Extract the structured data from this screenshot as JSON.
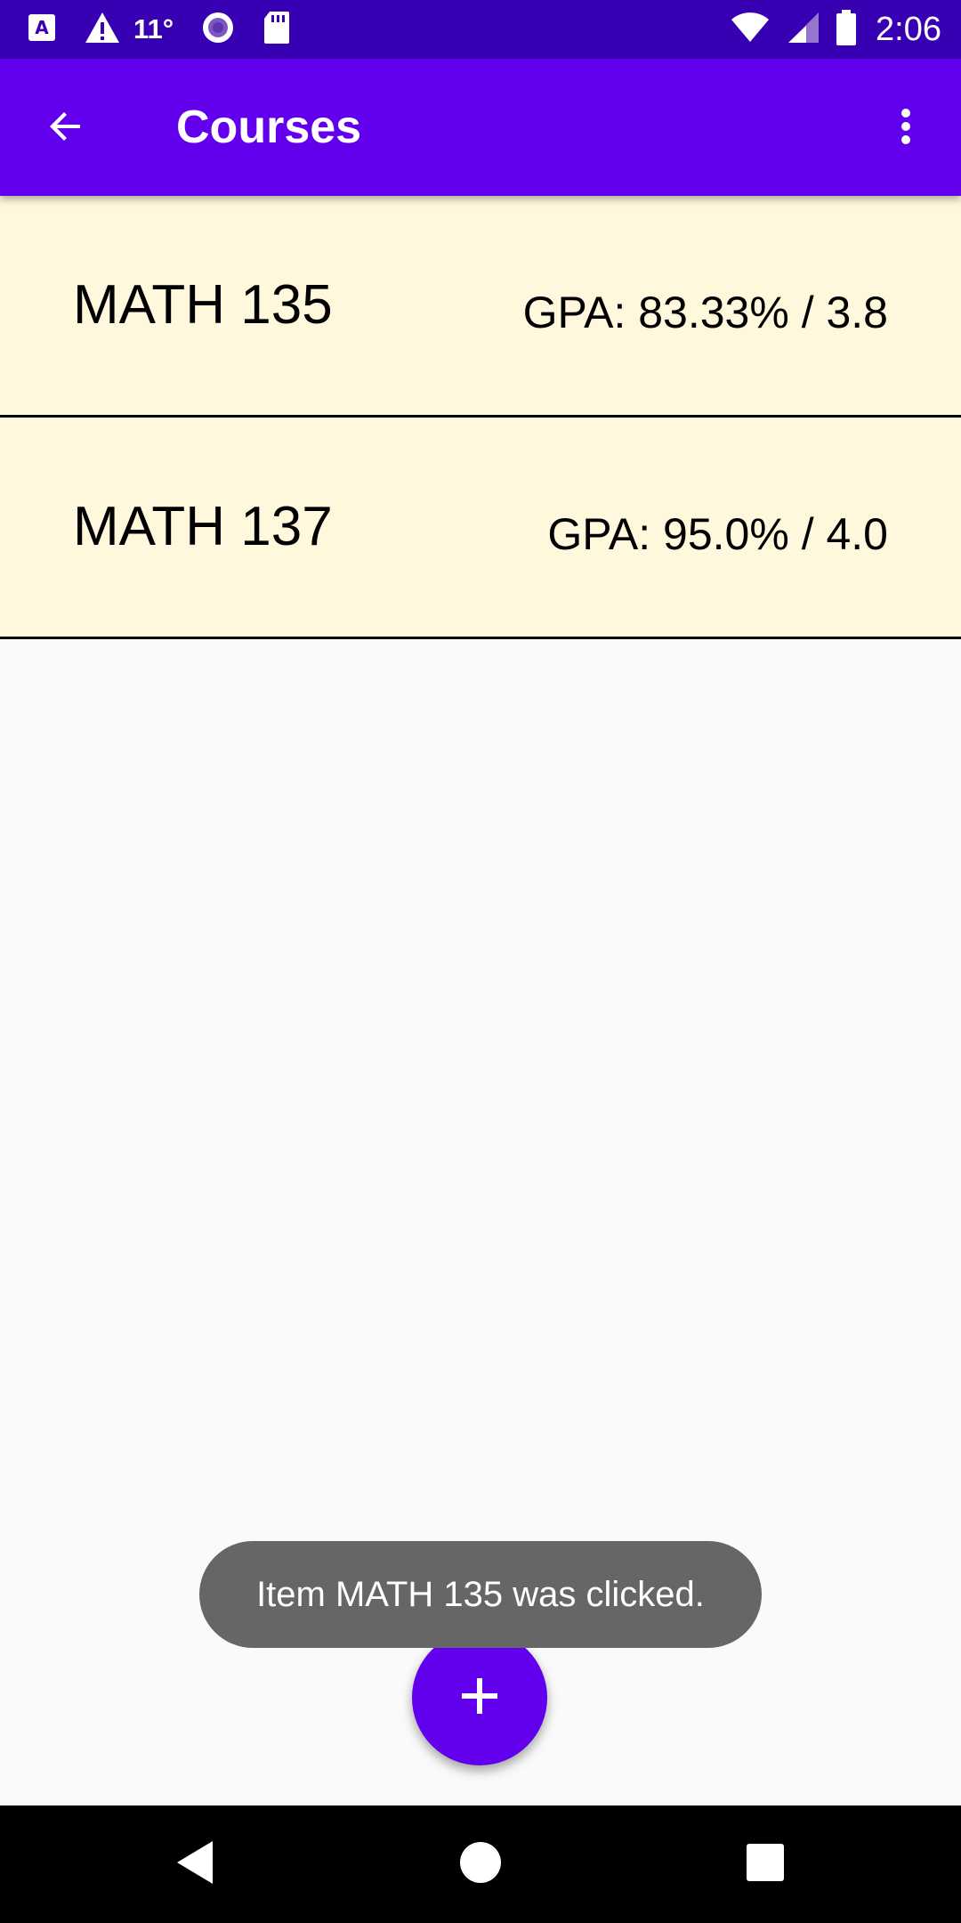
{
  "status_bar": {
    "temperature": "11°",
    "time": "2:06",
    "icons": [
      "keyboard-a-icon",
      "warning-icon",
      "radio-circle-icon",
      "sd-card-icon",
      "wifi-icon",
      "signal-icon",
      "battery-icon"
    ]
  },
  "app_bar": {
    "title": "Courses",
    "back_icon": "arrow-back-icon",
    "menu_icon": "more-vert-icon"
  },
  "courses": [
    {
      "name": "MATH 135",
      "gpa": "GPA: 83.33% / 3.8"
    },
    {
      "name": "MATH 137",
      "gpa": "GPA: 95.0% / 4.0"
    }
  ],
  "toast": {
    "message": "Item MATH 135 was clicked."
  },
  "fab": {
    "icon": "add-icon"
  },
  "nav_bar": {
    "icons": [
      "back-triangle-icon",
      "home-circle-icon",
      "recents-square-icon"
    ]
  },
  "colors": {
    "status_bar": "#3700b3",
    "app_bar": "#6200ee",
    "list_item": "#fff8dc",
    "toast": "#666666",
    "fab": "#6200ee"
  }
}
